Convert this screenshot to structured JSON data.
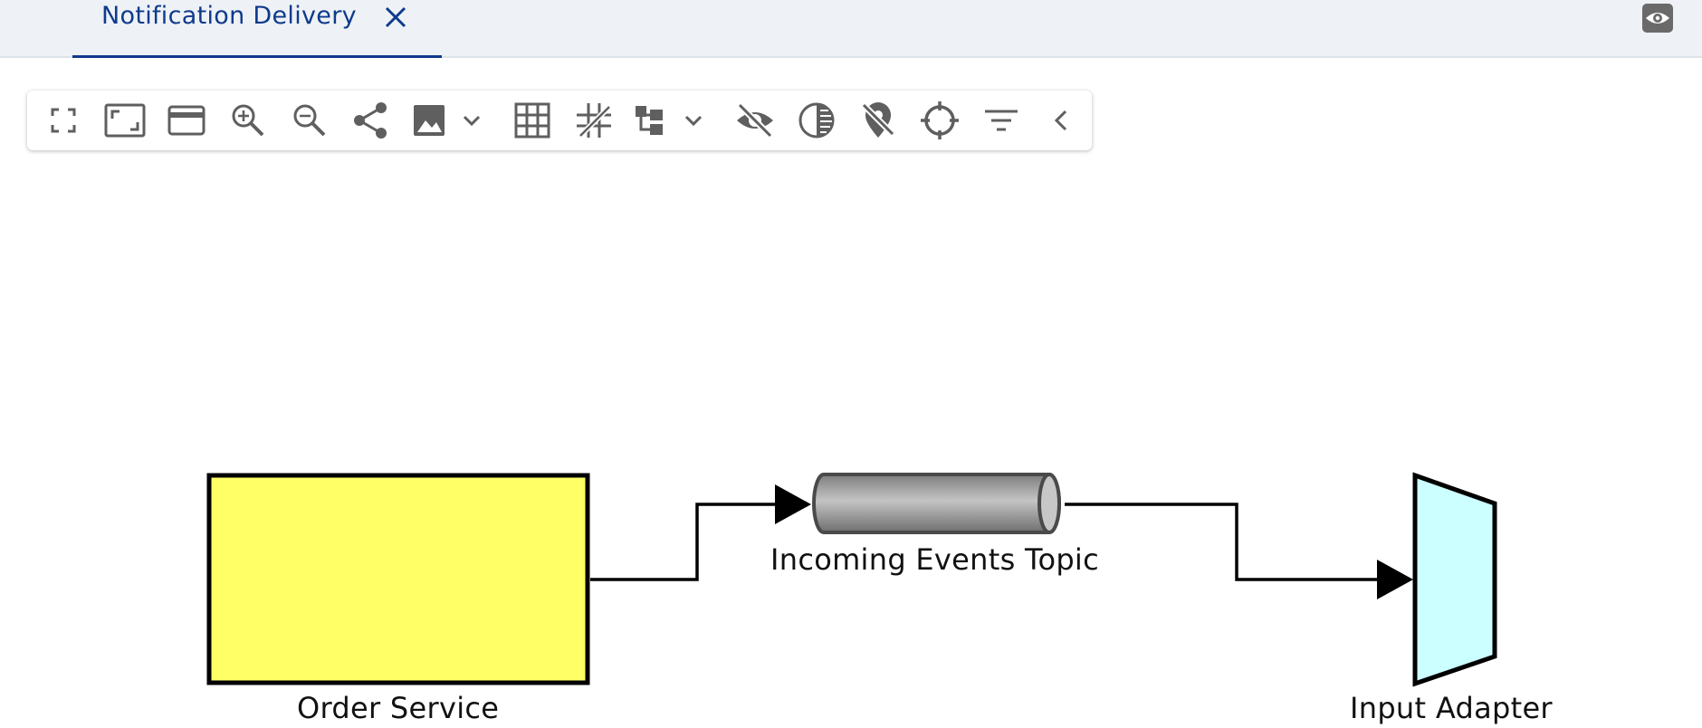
{
  "tabs": [
    {
      "label": "Notification Delivery",
      "active": true
    }
  ],
  "tabbar": {
    "right_icon": "eye-icon"
  },
  "toolbar": {
    "buttons": [
      {
        "icon": "fullscreen-icon"
      },
      {
        "icon": "fit-to-screen-icon"
      },
      {
        "icon": "card-view-icon"
      },
      {
        "icon": "zoom-in-icon"
      },
      {
        "icon": "zoom-out-icon"
      },
      {
        "icon": "share-icon"
      },
      {
        "icon": "image-export-icon",
        "has_dropdown": true
      },
      {
        "icon": "grid-icon"
      },
      {
        "icon": "snap-lines-icon"
      },
      {
        "icon": "layout-hierarchy-icon",
        "has_dropdown": true
      },
      {
        "icon": "hide-icon"
      },
      {
        "icon": "contrast-icon"
      },
      {
        "icon": "location-off-icon"
      },
      {
        "icon": "crosshair-icon"
      },
      {
        "icon": "filter-icon"
      },
      {
        "icon": "collapse-icon"
      }
    ]
  },
  "diagram": {
    "nodes": [
      {
        "id": "order-service",
        "label": "Order Service",
        "shape": "rectangle",
        "fill": "#ffff66"
      },
      {
        "id": "incoming-events-topic",
        "label": "Incoming Events Topic",
        "shape": "cylinder",
        "fill": "#a9a9a9"
      },
      {
        "id": "input-adapter",
        "label": "Input Adapter",
        "shape": "trapezoid",
        "fill": "#ccffff"
      }
    ],
    "edges": [
      {
        "from": "order-service",
        "to": "incoming-events-topic"
      },
      {
        "from": "incoming-events-topic",
        "to": "input-adapter"
      }
    ]
  },
  "colors": {
    "accent": "#0f3a8c",
    "tabbar_bg": "#eef2f6",
    "icon": "#5f5f5f"
  }
}
